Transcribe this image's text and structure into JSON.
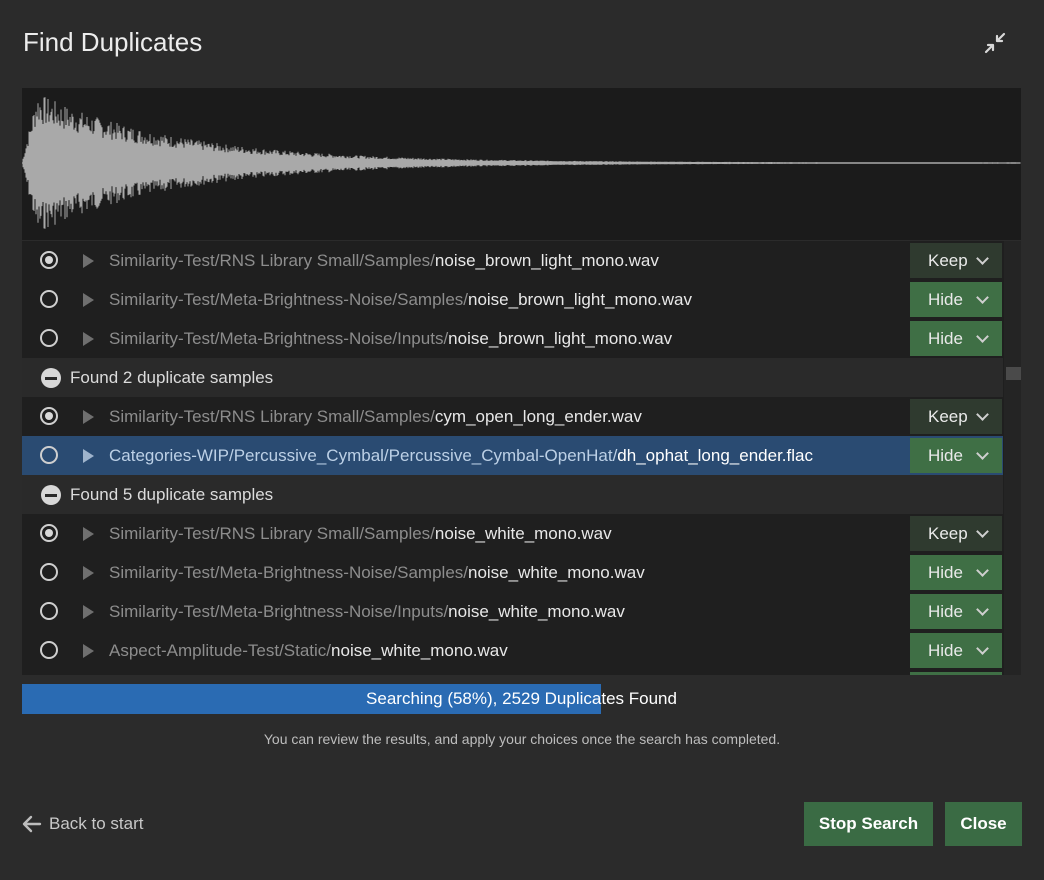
{
  "dialog": {
    "title": "Find Duplicates",
    "collapse_icon": "collapse-arrows-icon"
  },
  "groups_top": {
    "rows": [
      {
        "dir": "Similarity-Test/RNS Library Small/Samples/",
        "file": "noise_brown_light_mono.wav",
        "action": "Keep",
        "checked": true
      },
      {
        "dir": "Similarity-Test/Meta-Brightness-Noise/Samples/",
        "file": "noise_brown_light_mono.wav",
        "action": "Hide",
        "checked": false
      },
      {
        "dir": "Similarity-Test/Meta-Brightness-Noise/Inputs/",
        "file": "noise_brown_light_mono.wav",
        "action": "Hide",
        "checked": false
      }
    ]
  },
  "group2": {
    "header": "Found 2 duplicate samples",
    "rows": [
      {
        "dir": "Similarity-Test/RNS Library Small/Samples/",
        "file": "cym_open_long_ender.wav",
        "action": "Keep",
        "checked": true
      },
      {
        "dir": "Categories-WIP/Percussive_Cymbal/Percussive_Cymbal-OpenHat/",
        "file": "dh_ophat_long_ender.flac",
        "action": "Hide",
        "checked": false
      }
    ]
  },
  "group3": {
    "header": "Found 5 duplicate samples",
    "rows": [
      {
        "dir": "Similarity-Test/RNS Library Small/Samples/",
        "file": "noise_white_mono.wav",
        "action": "Keep",
        "checked": true
      },
      {
        "dir": "Similarity-Test/Meta-Brightness-Noise/Samples/",
        "file": "noise_white_mono.wav",
        "action": "Hide",
        "checked": false
      },
      {
        "dir": "Similarity-Test/Meta-Brightness-Noise/Inputs/",
        "file": "noise_white_mono.wav",
        "action": "Hide",
        "checked": false
      },
      {
        "dir": "Aspect-Amplitude-Test/Static/",
        "file": "noise_white_mono.wav",
        "action": "Hide",
        "checked": false
      }
    ]
  },
  "progress": {
    "percent": 58,
    "text": "Searching (58%), 2529 Duplicates Found"
  },
  "hint": "You can review the results, and apply your choices once the search has completed.",
  "footer": {
    "back_label": "Back to start",
    "stop_label": "Stop Search",
    "close_label": "Close"
  },
  "colors": {
    "accent_blue": "#2a6bb3",
    "selected_row": "#2a4b72",
    "hide_green": "#3f6f45",
    "keep_dark": "#2f3a2f",
    "button_green": "#3a6b44"
  }
}
